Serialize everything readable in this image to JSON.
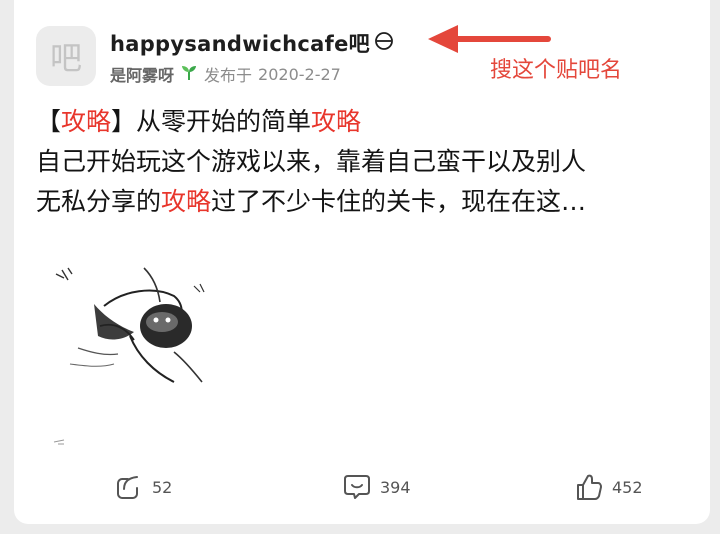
{
  "post": {
    "avatar_char": "吧",
    "forum_name": "happysandwichcafe吧",
    "author": "是阿雾呀",
    "posted_prefix": "发布于",
    "date": "2020-2-27",
    "title_parts": [
      "【",
      "攻略",
      "】从零开始的简单",
      "攻略"
    ],
    "body_line1": "自己开始玩这个游戏以来，靠着自己蛮干以及别人",
    "body_line2_parts": [
      "无私分享的",
      "攻略",
      "过了不少卡住的关卡，现在在这…"
    ]
  },
  "annotation": {
    "text": "搜这个贴吧名",
    "color": "#e4473b"
  },
  "actions": {
    "share_count": "52",
    "comment_count": "394",
    "like_count": "452"
  },
  "colors": {
    "highlight": "#e8362c",
    "card_bg": "#ffffff",
    "page_bg": "#ececec"
  },
  "icons": [
    "ban-icon",
    "sprout-icon",
    "share-icon",
    "comment-icon",
    "thumbs-up-icon"
  ]
}
